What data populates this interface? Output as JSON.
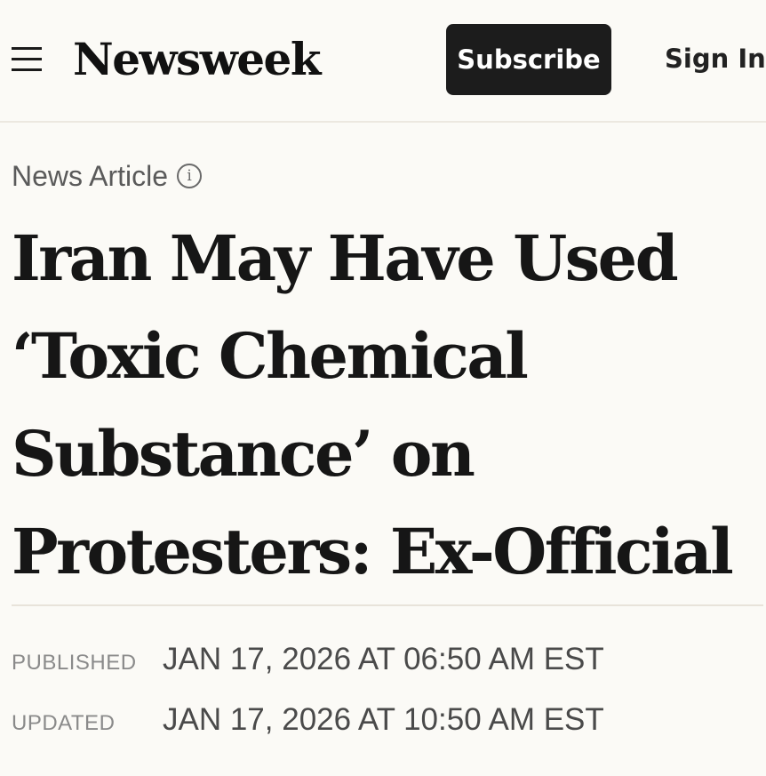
{
  "header": {
    "logo": "Newsweek",
    "subscribe_label": "Subscribe",
    "signin_label": "Sign In",
    "icons": {
      "menu": "hamburger-menu-icon"
    }
  },
  "article": {
    "kicker": "News Article",
    "kicker_icon": "info-icon",
    "info_glyph": "i",
    "headline_lines": [
      "Iran May Have Used",
      "‘Toxic Chemical",
      "Substance’ on",
      "Protesters: Ex-Official"
    ],
    "published_label": "PUBLISHED",
    "published_value": "JAN 17, 2026 AT 06:50 AM EST",
    "updated_label": "UPDATED",
    "updated_value": "JAN 17, 2026 AT 10:50 AM EST"
  },
  "colors": {
    "background": "#fbfaf6",
    "button": "#1c1c1c",
    "text": "#161616"
  }
}
